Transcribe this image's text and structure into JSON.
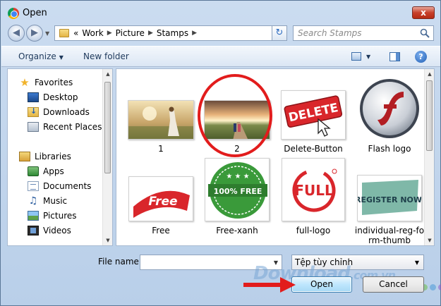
{
  "window": {
    "title": "Open",
    "close_glyph": "x"
  },
  "address": {
    "overflow": "«",
    "crumbs": [
      "Work",
      "Picture",
      "Stamps"
    ],
    "search_placeholder": "Search Stamps"
  },
  "toolbar": {
    "organize_label": "Organize",
    "new_folder_label": "New folder"
  },
  "nav": {
    "favorites_label": "Favorites",
    "favorites": [
      "Desktop",
      "Downloads",
      "Recent Places"
    ],
    "libraries_label": "Libraries",
    "libraries": [
      "Apps",
      "Documents",
      "Music",
      "Pictures",
      "Videos"
    ]
  },
  "files": [
    {
      "name": "1",
      "icon": "sunset-girl-thumbnail"
    },
    {
      "name": "2",
      "icon": "couple-road-thumbnail"
    },
    {
      "name": "Delete-Button",
      "icon": "delete-button-thumbnail",
      "text": "DELETE"
    },
    {
      "name": "Flash logo",
      "icon": "flash-logo-thumbnail"
    },
    {
      "name": "Free",
      "icon": "free-badge-thumbnail",
      "text": "Free"
    },
    {
      "name": "Free-xanh",
      "icon": "free-green-stamp-thumbnail",
      "text": "100% FREE"
    },
    {
      "name": "full-logo",
      "icon": "full-logo-thumbnail",
      "text": "FULL"
    },
    {
      "name": "individual-reg-fo rm-thumb",
      "line1": "individual-reg-fo",
      "line2": "rm-thumb",
      "icon": "register-now-thumbnail",
      "text": "REGISTER NOW!"
    }
  ],
  "footer": {
    "file_name_label": "File name:",
    "file_name_value": "",
    "filter_value": "Tệp tùy chỉnh",
    "open_label": "Open",
    "cancel_label": "Cancel"
  },
  "watermark": {
    "text": "Download",
    "suffix": ".com.vn"
  },
  "colors": {
    "highlight_ring": "#e21c1c",
    "arrow": "#e21c1c"
  }
}
